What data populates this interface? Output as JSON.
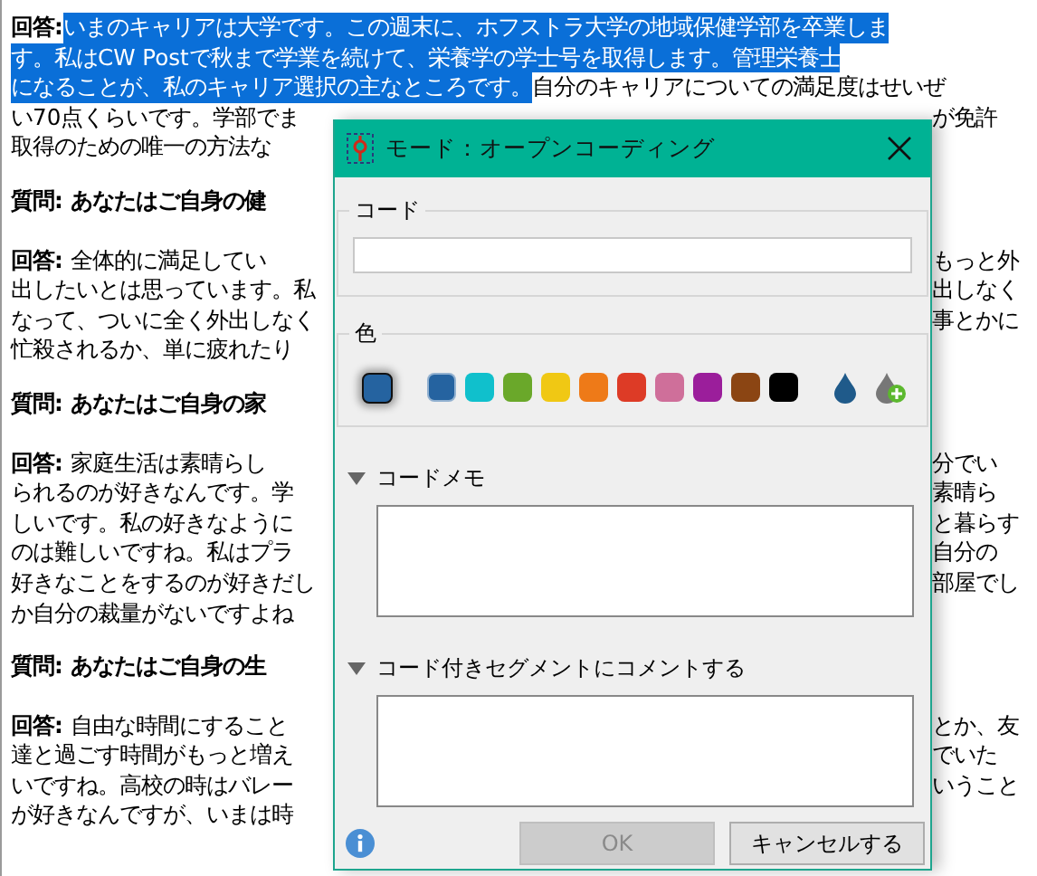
{
  "document": {
    "paragraphs": [
      {
        "kind": "answer",
        "lines": [
          {
            "kind": "full",
            "segments": [
              {
                "text": "**回答:**",
                "highlighted": false
              },
              {
                "text": "いまのキャリアは大学です。この週末に、ホフストラ大学の地域保健学部を卒業しま",
                "highlighted": true
              }
            ]
          },
          {
            "kind": "full",
            "segments": [
              {
                "text": "す。私はCW Postで秋まで学業を続けて、栄養学の学士号を取得します。管理栄養士",
                "highlighted": true
              }
            ]
          },
          {
            "kind": "full",
            "segments": [
              {
                "text": "になることが、私のキャリア選択の主なところです。",
                "highlighted": true
              },
              {
                "text": "自分のキャリアについての満足度はせいぜ",
                "highlighted": false
              }
            ]
          },
          {
            "kind": "split",
            "left": "い70点くらいです。学部でま",
            "right": "が免許"
          },
          {
            "kind": "split",
            "left": "取得のための唯一の方法な"
          }
        ]
      },
      {
        "kind": "question",
        "lines": [
          {
            "kind": "split",
            "left": "質問: あなたはご自身の健"
          }
        ]
      },
      {
        "kind": "answer",
        "lines": [
          {
            "kind": "split",
            "left": "**回答:** 全体的に満足してい",
            "right": "もっと外"
          },
          {
            "kind": "split",
            "left": "出したいとは思っています。私",
            "right": "出しなく"
          },
          {
            "kind": "split",
            "left": "なって、ついに全く外出しなく",
            "right": "事とかに"
          },
          {
            "kind": "split",
            "left": "忙殺されるか、単に疲れたり"
          }
        ]
      },
      {
        "kind": "question",
        "lines": [
          {
            "kind": "split",
            "left": "質問: あなたはご自身の家"
          }
        ]
      },
      {
        "kind": "answer",
        "lines": [
          {
            "kind": "split",
            "left": "**回答:** 家庭生活は素晴らし",
            "right": "分でい"
          },
          {
            "kind": "split",
            "left": "られるのが好きなんです。学",
            "right": "素晴ら"
          },
          {
            "kind": "split",
            "left": "しいです。私の好きなように",
            "right": "と暮らす"
          },
          {
            "kind": "split",
            "left": "のは難しいですね。私はプラ",
            "right": "自分の"
          },
          {
            "kind": "split",
            "left": "好きなことをするのが好きだし",
            "right": "部屋でし"
          },
          {
            "kind": "split",
            "left": "か自分の裁量がないですよね"
          }
        ]
      },
      {
        "kind": "question",
        "lines": [
          {
            "kind": "split",
            "left": "質問: あなたはご自身の生"
          }
        ]
      },
      {
        "kind": "answer",
        "lines": [
          {
            "kind": "split",
            "left": "**回答:** 自由な時間にすること",
            "right": "とか、友"
          },
          {
            "kind": "split",
            "left": "達と過ごす時間がもっと増え",
            "right": "でいた"
          },
          {
            "kind": "split",
            "left": "いですね。高校の時はバレー",
            "right": "いうこと"
          },
          {
            "kind": "split",
            "left": "が好きなんですが、いまは時"
          }
        ]
      }
    ]
  },
  "dialog": {
    "title": "モード：オープンコーディング",
    "code_group": {
      "label": "コード"
    },
    "color_group": {
      "label": "色",
      "swatches": [
        {
          "color": "#2563a0",
          "selected": true
        },
        {
          "color": "#10c0cc",
          "selected": false
        },
        {
          "color": "#6aa82a",
          "selected": false
        },
        {
          "color": "#f0c814",
          "selected": false
        },
        {
          "color": "#ee7a18",
          "selected": false
        },
        {
          "color": "#dd3b26",
          "selected": false
        },
        {
          "color": "#cf6f9a",
          "selected": false
        },
        {
          "color": "#9b1e9b",
          "selected": false
        },
        {
          "color": "#8b4513",
          "selected": false
        },
        {
          "color": "#000000",
          "selected": false
        }
      ]
    },
    "sections": [
      {
        "label": "コードメモ",
        "expanded": true
      },
      {
        "label": "コード付きセグメントにコメントする",
        "expanded": true
      }
    ],
    "buttons": [
      {
        "label": "OK",
        "disabled": true
      },
      {
        "label": "キャンセルする",
        "disabled": false
      }
    ]
  }
}
